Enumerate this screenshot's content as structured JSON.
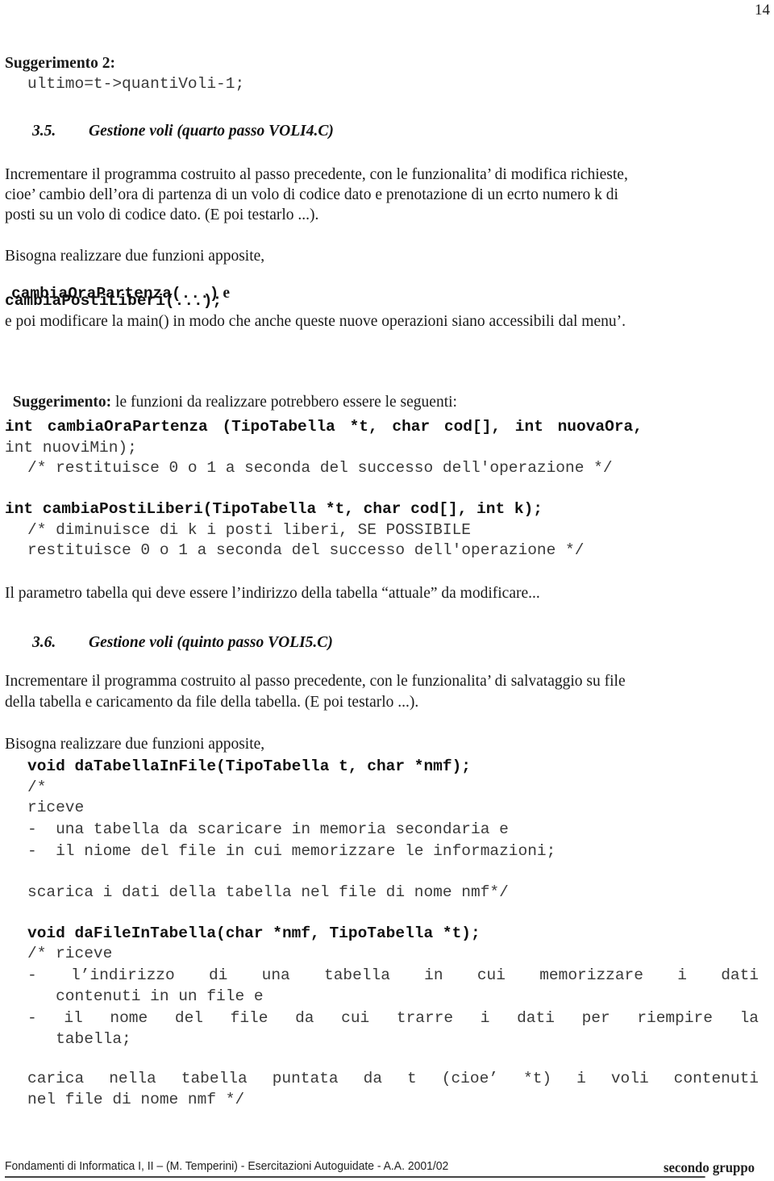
{
  "page_number": "14",
  "hint2": {
    "label": "Suggerimento 2:",
    "code": "ultimo=t->quantiVoli-1;"
  },
  "section_35": {
    "number": "3.5.",
    "title": "Gestione voli (quarto passo VOLI4.C)",
    "intro_lines": [
      "Incrementare il programma costruito al passo precedente, con le funzionalita’ di modifica richieste,",
      "cioe’ cambio dell’ora di partenza di un volo di codice dato e prenotazione di un ecrto numero k di",
      "posti su un volo di codice dato. (E poi testarlo ...)."
    ],
    "need_text": "Bisogna realizzare due funzioni apposite,",
    "func1_call": "cambiaOraPartenza(...)",
    "conj": " e",
    "func2_call": "cambiaPostiLiberi(...);",
    "main_text": "e poi modificare la main() in modo che anche queste nuove operazioni siano accessibili dal menu’.",
    "hint_label": "Suggerimento:",
    "hint_text": " le funzioni da realizzare potrebbero essere le seguenti:",
    "proto1_line1": "int cambiaOraPartenza (TipoTabella *t, char cod[], int nuovaOra,",
    "proto1_line2": "int nuoviMin);",
    "proto1_comment": "/* restituisce 0 o 1 a seconda del successo dell'operazione */",
    "proto2_line1": "int cambiaPostiLiberi(TipoTabella *t, char cod[], int k);",
    "proto2_comment_lines": [
      "/* diminuisce di k i posti liberi, SE POSSIBILE",
      "restituisce 0 o 1 a seconda del successo dell'operazione */"
    ],
    "param_note": "Il parametro tabella qui deve essere l’indirizzo della tabella “attuale” da modificare..."
  },
  "section_36": {
    "number": "3.6.",
    "title": "Gestione voli (quinto passo VOLI5.C)",
    "intro_lines": [
      "Incrementare il programma costruito al passo precedente, con le funzionalita’ di salvataggio su file",
      "della tabella e caricamento da file della tabella. (E poi testarlo ...)."
    ],
    "need_text": "Bisogna realizzare due funzioni apposite,",
    "proto1": "void daTabellaInFile(TipoTabella t, char *nmf);",
    "proto1_comment_lines": [
      "/*",
      "riceve",
      "-  una tabella da scaricare in memoria secondaria e",
      "-  il niome del file in cui memorizzare le informazioni;",
      "",
      "scarica i dati della tabella nel file di nome nmf*/"
    ],
    "proto2": "void daFileInTabella(char *nmf, TipoTabella *t);",
    "proto2_comment_lines": [
      "/* riceve",
      "-  l’indirizzo di una tabella in cui memorizzare i dati",
      "   contenuti in un file e",
      "-  il nome del file da cui trarre i dati per riempire la",
      "   tabella;",
      "",
      "carica nella tabella puntata da t (cioe’ *t) i voli contenuti",
      "nel file di nome nmf */"
    ]
  },
  "footer": {
    "left": "Fondamenti di Informatica I, II – (M. Temperini) - Esercitazioni Autoguidate - A.A. 2001/02",
    "right": "secondo gruppo"
  }
}
